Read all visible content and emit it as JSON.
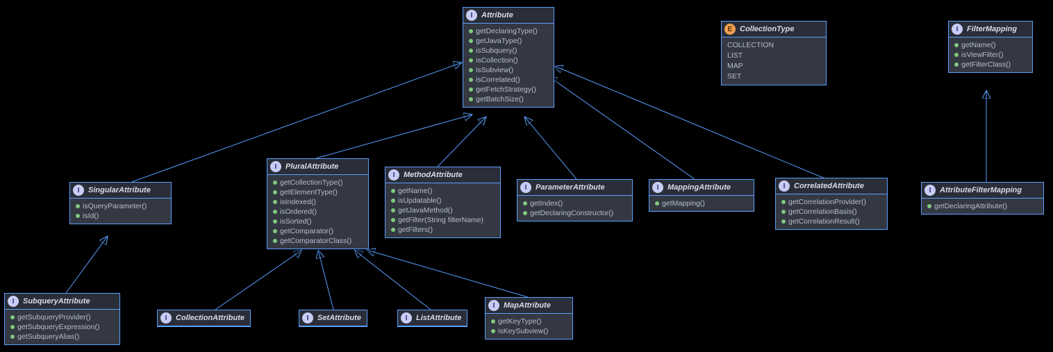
{
  "nodes": {
    "Attribute": {
      "kind": "I",
      "title": "Attribute",
      "members": [
        "getDeclaringType()",
        "getJavaType()",
        "isSubquery()",
        "isCollection()",
        "isSubview()",
        "isCorrelated()",
        "getFetchStrategy()",
        "getBatchSize()"
      ]
    },
    "SingularAttribute": {
      "kind": "I",
      "title": "SingularAttribute",
      "members": [
        "isQueryParameter()",
        "isId()"
      ]
    },
    "PluralAttribute": {
      "kind": "I",
      "title": "PluralAttribute",
      "members": [
        "getCollectionType()",
        "getElementType()",
        "isIndexed()",
        "isOrdered()",
        "isSorted()",
        "getComparator()",
        "getComparatorClass()"
      ]
    },
    "MethodAttribute": {
      "kind": "I",
      "title": "MethodAttribute",
      "members": [
        "getName()",
        "isUpdatable()",
        "getJavaMethod()",
        "getFilter(String filterName)",
        "getFilters()"
      ]
    },
    "ParameterAttribute": {
      "kind": "I",
      "title": "ParameterAttribute",
      "members": [
        "getIndex()",
        "getDeclaringConstructor()"
      ]
    },
    "MappingAttribute": {
      "kind": "I",
      "title": "MappingAttribute",
      "members": [
        "getMapping()"
      ]
    },
    "CorrelatedAttribute": {
      "kind": "I",
      "title": "CorrelatedAttribute",
      "members": [
        "getCorrelationProvider()",
        "getCorrelationBasis()",
        "getCorrelationResult()"
      ]
    },
    "SubqueryAttribute": {
      "kind": "I",
      "title": "SubqueryAttribute",
      "members": [
        "getSubqueryProvider()",
        "getSubqueryExpression()",
        "getSubqueryAlias()"
      ]
    },
    "CollectionAttribute": {
      "kind": "I",
      "title": "CollectionAttribute",
      "members": []
    },
    "SetAttribute": {
      "kind": "I",
      "title": "SetAttribute",
      "members": []
    },
    "ListAttribute": {
      "kind": "I",
      "title": "ListAttribute",
      "members": []
    },
    "MapAttribute": {
      "kind": "I",
      "title": "MapAttribute",
      "members": [
        "getKeyType()",
        "isKeySubview()"
      ]
    },
    "CollectionType": {
      "kind": "E",
      "title": "CollectionType",
      "enumItems": [
        "COLLECTION",
        "LIST",
        "MAP",
        "SET"
      ]
    },
    "FilterMapping": {
      "kind": "I",
      "title": "FilterMapping",
      "members": [
        "getName()",
        "isViewFilter()",
        "getFilterClass()"
      ]
    },
    "AttributeFilterMapping": {
      "kind": "I",
      "title": "AttributeFilterMapping",
      "members": [
        "getDeclaringAttribute()"
      ]
    }
  },
  "chart_data": {
    "type": "uml-class-diagram",
    "relationships": [
      {
        "from": "SingularAttribute",
        "to": "Attribute",
        "type": "generalization"
      },
      {
        "from": "PluralAttribute",
        "to": "Attribute",
        "type": "generalization"
      },
      {
        "from": "MethodAttribute",
        "to": "Attribute",
        "type": "generalization"
      },
      {
        "from": "ParameterAttribute",
        "to": "Attribute",
        "type": "generalization"
      },
      {
        "from": "MappingAttribute",
        "to": "Attribute",
        "type": "generalization"
      },
      {
        "from": "CorrelatedAttribute",
        "to": "Attribute",
        "type": "generalization"
      },
      {
        "from": "SubqueryAttribute",
        "to": "SingularAttribute",
        "type": "generalization"
      },
      {
        "from": "CollectionAttribute",
        "to": "PluralAttribute",
        "type": "generalization"
      },
      {
        "from": "SetAttribute",
        "to": "PluralAttribute",
        "type": "generalization"
      },
      {
        "from": "ListAttribute",
        "to": "PluralAttribute",
        "type": "generalization"
      },
      {
        "from": "MapAttribute",
        "to": "PluralAttribute",
        "type": "generalization"
      },
      {
        "from": "AttributeFilterMapping",
        "to": "FilterMapping",
        "type": "generalization"
      }
    ]
  }
}
